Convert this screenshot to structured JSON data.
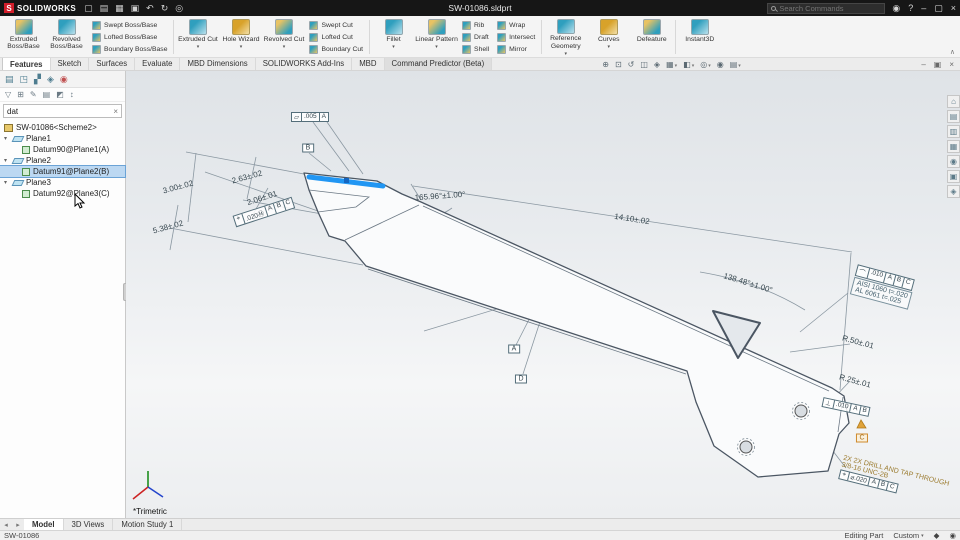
{
  "ui": {
    "dropdown": "▾",
    "expand": "▾",
    "collapse_ribbon": "∧"
  },
  "title_bar": {
    "logo_text": "SOLIDWORKS",
    "document_title": "SW-01086.sldprt",
    "search_placeholder": "Search Commands",
    "menu_icons": [
      {
        "name": "new",
        "glyph": "▢"
      },
      {
        "name": "open",
        "glyph": "▤"
      },
      {
        "name": "save",
        "glyph": "▦"
      },
      {
        "name": "print",
        "glyph": "▣"
      },
      {
        "name": "undo",
        "glyph": "↶"
      },
      {
        "name": "rebuild",
        "glyph": "↻"
      },
      {
        "name": "options",
        "glyph": "◎"
      }
    ],
    "right_icons": [
      {
        "name": "login",
        "glyph": "◉"
      },
      {
        "name": "help",
        "glyph": "?"
      },
      {
        "name": "minimize",
        "glyph": "–"
      },
      {
        "name": "maximize",
        "glyph": "▢"
      },
      {
        "name": "close",
        "glyph": "×"
      }
    ]
  },
  "ribbon": {
    "big": [
      "Extruded Boss/Base",
      "Revolved Boss/Base",
      "Extruded Cut",
      "Hole Wizard",
      "Revolved Cut",
      "Fillet",
      "Linear Pattern",
      "Reference Geometry",
      "Curves",
      "Defeature",
      "Instant3D"
    ],
    "stacks": [
      [
        "Swept Boss/Base",
        "Lofted Boss/Base",
        "Boundary Boss/Base"
      ],
      [
        "Swept Cut",
        "Lofted Cut",
        "Boundary Cut"
      ],
      [
        "Rib",
        "Draft",
        "Shell"
      ],
      [
        "Wrap",
        "Intersect",
        "Mirror"
      ]
    ]
  },
  "tabs": {
    "items": [
      "Features",
      "Sketch",
      "Surfaces",
      "Evaluate",
      "MBD Dimensions",
      "SOLIDWORKS Add-Ins",
      "MBD",
      "Command Predictor (Beta)"
    ]
  },
  "headsup": [
    {
      "name": "zoom-fit",
      "glyph": "⊕"
    },
    {
      "name": "zoom-area",
      "glyph": "⊡"
    },
    {
      "name": "previous-view",
      "glyph": "↺"
    },
    {
      "name": "section-view",
      "glyph": "◫"
    },
    {
      "name": "annotation-views",
      "glyph": "◈"
    },
    {
      "name": "view-orientation",
      "glyph": "▦"
    },
    {
      "name": "display-style",
      "glyph": "◧"
    },
    {
      "name": "hide-show-items",
      "glyph": "◎"
    },
    {
      "name": "edit-appearance",
      "glyph": "◉"
    },
    {
      "name": "view-settings",
      "glyph": "▤"
    }
  ],
  "window_controls": [
    {
      "name": "minimize",
      "glyph": "–"
    },
    {
      "name": "restore",
      "glyph": "▣"
    },
    {
      "name": "close",
      "glyph": "×"
    }
  ],
  "feature_panel": {
    "panel_tabs": [
      {
        "name": "featuremanager",
        "glyph": "▤"
      },
      {
        "name": "propertymanager",
        "glyph": "◳"
      },
      {
        "name": "configurationmanager",
        "glyph": "▞"
      },
      {
        "name": "dimxpertmanager",
        "glyph": "◈"
      },
      {
        "name": "displaymanager",
        "glyph": "◉"
      }
    ],
    "filter_icons": [
      {
        "name": "filter-dropdown",
        "glyph": "▽"
      },
      {
        "name": "filter-graphics",
        "glyph": "⊞"
      },
      {
        "name": "filter-annotations",
        "glyph": "✎"
      },
      {
        "name": "filter-features",
        "glyph": "▤"
      },
      {
        "name": "filter-tags",
        "glyph": "◩"
      },
      {
        "name": "filter-history",
        "glyph": "↕"
      }
    ],
    "search_value": "dat",
    "clear_glyph": "×",
    "tree": {
      "root": "SW-01086<Scheme2>",
      "nodes": [
        {
          "label": "Plane1",
          "child": "Datum90@Plane1(A)"
        },
        {
          "label": "Plane2",
          "child": "Datum91@Plane2(B)"
        },
        {
          "label": "Plane3",
          "child": "Datum92@Plane3(C)"
        }
      ]
    }
  },
  "viewport": {
    "view_label": "*Trimetric",
    "dims": {
      "d300": "3.00±.02",
      "d263": "2.63±.02",
      "d538": "5.38±.02",
      "d206": "2.06±.01",
      "a16596": "165.96°±1.00°",
      "d1410": "14.10±.02",
      "a13848": "138.48°±1.00°",
      "r50": "R.50±.01",
      "r25": "R.25±.01"
    },
    "fcf": {
      "flatness": {
        "cells": [
          "▱",
          ".005",
          "A"
        ]
      },
      "position1": {
        "cells": [
          "⌖",
          ".020Ⓜ",
          "A",
          "B",
          "C"
        ]
      },
      "profile": {
        "cells": [
          "⌒",
          ".010",
          "A",
          "B",
          "C"
        ]
      },
      "perp": {
        "cells": [
          "⊥",
          ".010",
          "A",
          "B"
        ]
      },
      "position2": {
        "cells": [
          "⌖",
          "⌀.020",
          "A",
          "B",
          "C"
        ]
      }
    },
    "datums": {
      "a": "A",
      "b": "B",
      "c": "C",
      "d": "D"
    },
    "notes": {
      "material_1": "AISI 1060 t=.020",
      "material_2": "AL 6061 t=.025",
      "drill_1": "2X 2X DRILL AND TAP THROUGH",
      "drill_2": "3/8-16 UNC-2B"
    }
  },
  "task_pane": [
    {
      "name": "solidworks-resources",
      "glyph": "⌂"
    },
    {
      "name": "design-library",
      "glyph": "▤"
    },
    {
      "name": "file-explorer",
      "glyph": "▥"
    },
    {
      "name": "view-palette",
      "glyph": "▦"
    },
    {
      "name": "appearances",
      "glyph": "◉"
    },
    {
      "name": "custom-properties",
      "glyph": "▣"
    },
    {
      "name": "forum",
      "glyph": "◈"
    }
  ],
  "doc_tabs": {
    "icons": [
      {
        "name": "tab-prev",
        "glyph": "◂"
      },
      {
        "name": "tab-next",
        "glyph": "▸"
      }
    ],
    "items": [
      "Model",
      "3D Views",
      "Motion Study 1"
    ]
  },
  "status_bar": {
    "left": "SW-01086",
    "editing": "Editing Part",
    "config": "Custom",
    "icons": [
      {
        "name": "status-units",
        "glyph": "◆"
      },
      {
        "name": "status-help",
        "glyph": "◉"
      }
    ]
  }
}
